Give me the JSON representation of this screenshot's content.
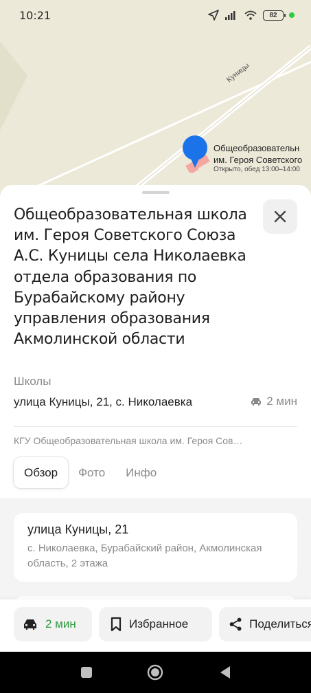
{
  "status_bar": {
    "time": "10:21",
    "battery": "82"
  },
  "map": {
    "street_label": "Куницы",
    "poi_name_line1": "Общеобразовательн",
    "poi_name_line2": "им. Героя Советского",
    "poi_hours": "Открыто, обед 13:00–14:00",
    "pin_color": "#1a73e8"
  },
  "place": {
    "title": "Общеобразовательная школа им. Героя Советского Союза А.С. Куницы села Николаевка отдела образования по Бурабайскому району управления образования Акмолинской области",
    "category": "Школы",
    "address": "улица Куницы, 21, с. Николаевка",
    "drive_time": "2 мин",
    "legal_name": "КГУ Общеобразовательная школа им. Героя Сов…"
  },
  "tabs": [
    {
      "label": "Обзор",
      "active": true
    },
    {
      "label": "Фото",
      "active": false
    },
    {
      "label": "Инфо",
      "active": false
    }
  ],
  "address_card": {
    "title": "улица Куницы, 21",
    "subtitle": "с. Николаевка, Бурабайский район, Акмолинская область, 2 этажа"
  },
  "actions": {
    "route_label": "2 мин",
    "favorites_label": "Избранное",
    "share_label": "Поделиться"
  },
  "colors": {
    "accent_green": "#2e9c3e",
    "map_bg": "#ece9d8"
  }
}
